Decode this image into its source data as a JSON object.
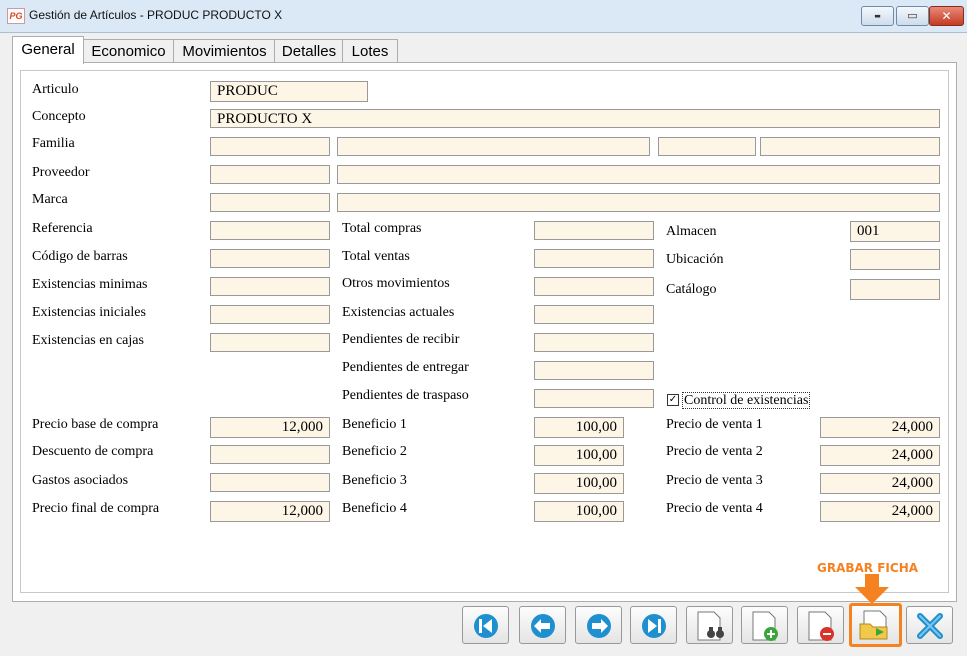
{
  "window": {
    "icon_text": "PG",
    "title": "Gestión de Artículos - PRODUC PRODUCTO X"
  },
  "tabs": [
    "General",
    "Economico",
    "Movimientos",
    "Detalles",
    "Lotes"
  ],
  "col1": {
    "articulo": {
      "label": "Articulo",
      "value": "PRODUC"
    },
    "concepto": {
      "label": "Concepto",
      "value": "PRODUCTO X"
    },
    "familia": {
      "label": "Familia"
    },
    "proveedor": {
      "label": "Proveedor"
    },
    "marca": {
      "label": "Marca"
    },
    "referencia": {
      "label": "Referencia",
      "value": ""
    },
    "codigo_barras": {
      "label": "Código de barras",
      "value": ""
    },
    "existencias_minimas": {
      "label": "Existencias minimas",
      "value": ""
    },
    "existencias_iniciales": {
      "label": "Existencias iniciales",
      "value": ""
    },
    "existencias_cajas": {
      "label": "Existencias en cajas",
      "value": ""
    },
    "precio_base_compra": {
      "label": "Precio base de compra",
      "value": "12,000"
    },
    "descuento_compra": {
      "label": "Descuento de compra",
      "value": ""
    },
    "gastos_asociados": {
      "label": "Gastos asociados",
      "value": ""
    },
    "precio_final_compra": {
      "label": "Precio final de compra",
      "value": "12,000"
    }
  },
  "col2": {
    "total_compras": {
      "label": "Total compras",
      "value": ""
    },
    "total_ventas": {
      "label": "Total ventas",
      "value": ""
    },
    "otros_movimientos": {
      "label": "Otros movimientos",
      "value": ""
    },
    "existencias_actuales": {
      "label": "Existencias actuales",
      "value": ""
    },
    "pendientes_recibir": {
      "label": "Pendientes de recibir",
      "value": ""
    },
    "pendientes_entregar": {
      "label": "Pendientes de entregar",
      "value": ""
    },
    "pendientes_traspaso": {
      "label": "Pendientes de traspaso",
      "value": ""
    },
    "beneficio_1": {
      "label": "Beneficio 1",
      "value": "100,00"
    },
    "beneficio_2": {
      "label": "Beneficio 2",
      "value": "100,00"
    },
    "beneficio_3": {
      "label": "Beneficio 3",
      "value": "100,00"
    },
    "beneficio_4": {
      "label": "Beneficio 4",
      "value": "100,00"
    }
  },
  "col3": {
    "almacen": {
      "label": "Almacen",
      "value": "001"
    },
    "ubicacion": {
      "label": "Ubicación",
      "value": ""
    },
    "catalogo": {
      "label": "Catálogo",
      "value": ""
    },
    "control_existencias": {
      "label": "Control de existencias",
      "checked": true,
      "mark": "✓"
    },
    "precio_venta_1": {
      "label": "Precio de venta 1",
      "value": "24,000"
    },
    "precio_venta_2": {
      "label": "Precio de venta 2",
      "value": "24,000"
    },
    "precio_venta_3": {
      "label": "Precio de venta 3",
      "value": "24,000"
    },
    "precio_venta_4": {
      "label": "Precio de venta 4",
      "value": "24,000"
    }
  },
  "annotation": {
    "text": "GRABAR FICHA",
    "color": "#f58220"
  },
  "toolbar": {
    "buttons": [
      "first-record",
      "previous-record",
      "next-record",
      "last-record",
      "search",
      "new-record",
      "delete-record",
      "save-record",
      "close"
    ],
    "accent": "#1e8fcf"
  },
  "window_controls": {
    "minimize": "▬",
    "maximize": "▭",
    "close": "✕"
  }
}
